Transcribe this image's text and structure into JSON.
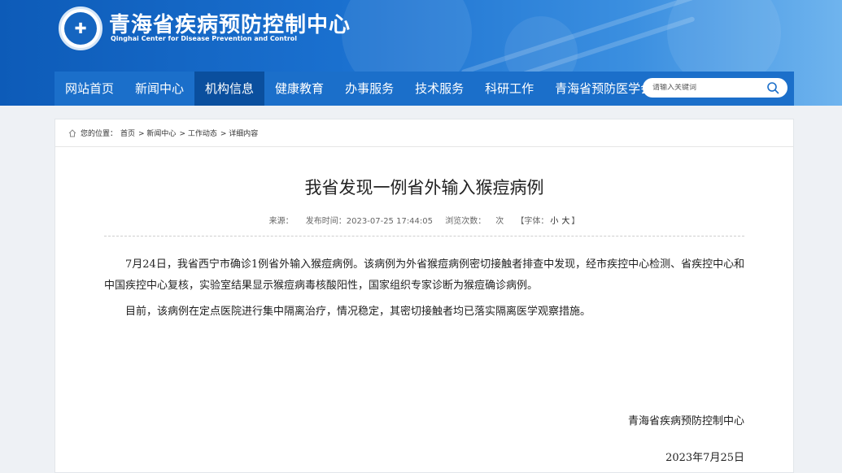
{
  "header": {
    "site_title": "青海省疾病预防控制中心",
    "site_subtitle": "Qinghai Center for Disease Prevention and Control",
    "emblem_icon": "cdc-emblem-icon"
  },
  "nav": {
    "items": [
      {
        "label": "网站首页"
      },
      {
        "label": "新闻中心"
      },
      {
        "label": "机构信息"
      },
      {
        "label": "健康教育"
      },
      {
        "label": "办事服务"
      },
      {
        "label": "技术服务"
      },
      {
        "label": "科研工作"
      },
      {
        "label": "青海省预防医学会"
      }
    ],
    "active_label": "机构信息",
    "search_placeholder": "请输入关键词"
  },
  "breadcrumb": {
    "prefix": "您的位置：",
    "items": [
      "首页",
      "> 新闻中心",
      "> 工作动态",
      "> 详细内容"
    ]
  },
  "article": {
    "title": "我省发现一例省外输入猴痘病例",
    "source_label": "来源：",
    "publish_label": "发布时间：",
    "publish_time": "2023-07-25 17:44:05",
    "views_label": "浏览次数：",
    "views_suffix": "次",
    "font_label": "【字体：",
    "font_small": "小",
    "font_large": "大",
    "font_close": "】",
    "paragraphs": [
      "7月24日，我省西宁市确诊1例省外输入猴痘病例。该病例为外省猴痘病例密切接触者排查中发现，经市疾控中心检测、省疾控中心和中国疾控中心复核，实验室结果显示猴痘病毒核酸阳性，国家组织专家诊断为猴痘确诊病例。",
      "目前，该病例在定点医院进行集中隔离治疗，情况稳定，其密切接触者均已落实隔离医学观察措施。"
    ],
    "signature": "青海省疾病预防控制中心",
    "date": "2023年7月25日"
  },
  "colors": {
    "nav_bg": "#1b6fca",
    "nav_active": "#0a4f9e",
    "header_gradient_start": "#0d5bb8",
    "header_gradient_end": "#6fb4ee"
  }
}
